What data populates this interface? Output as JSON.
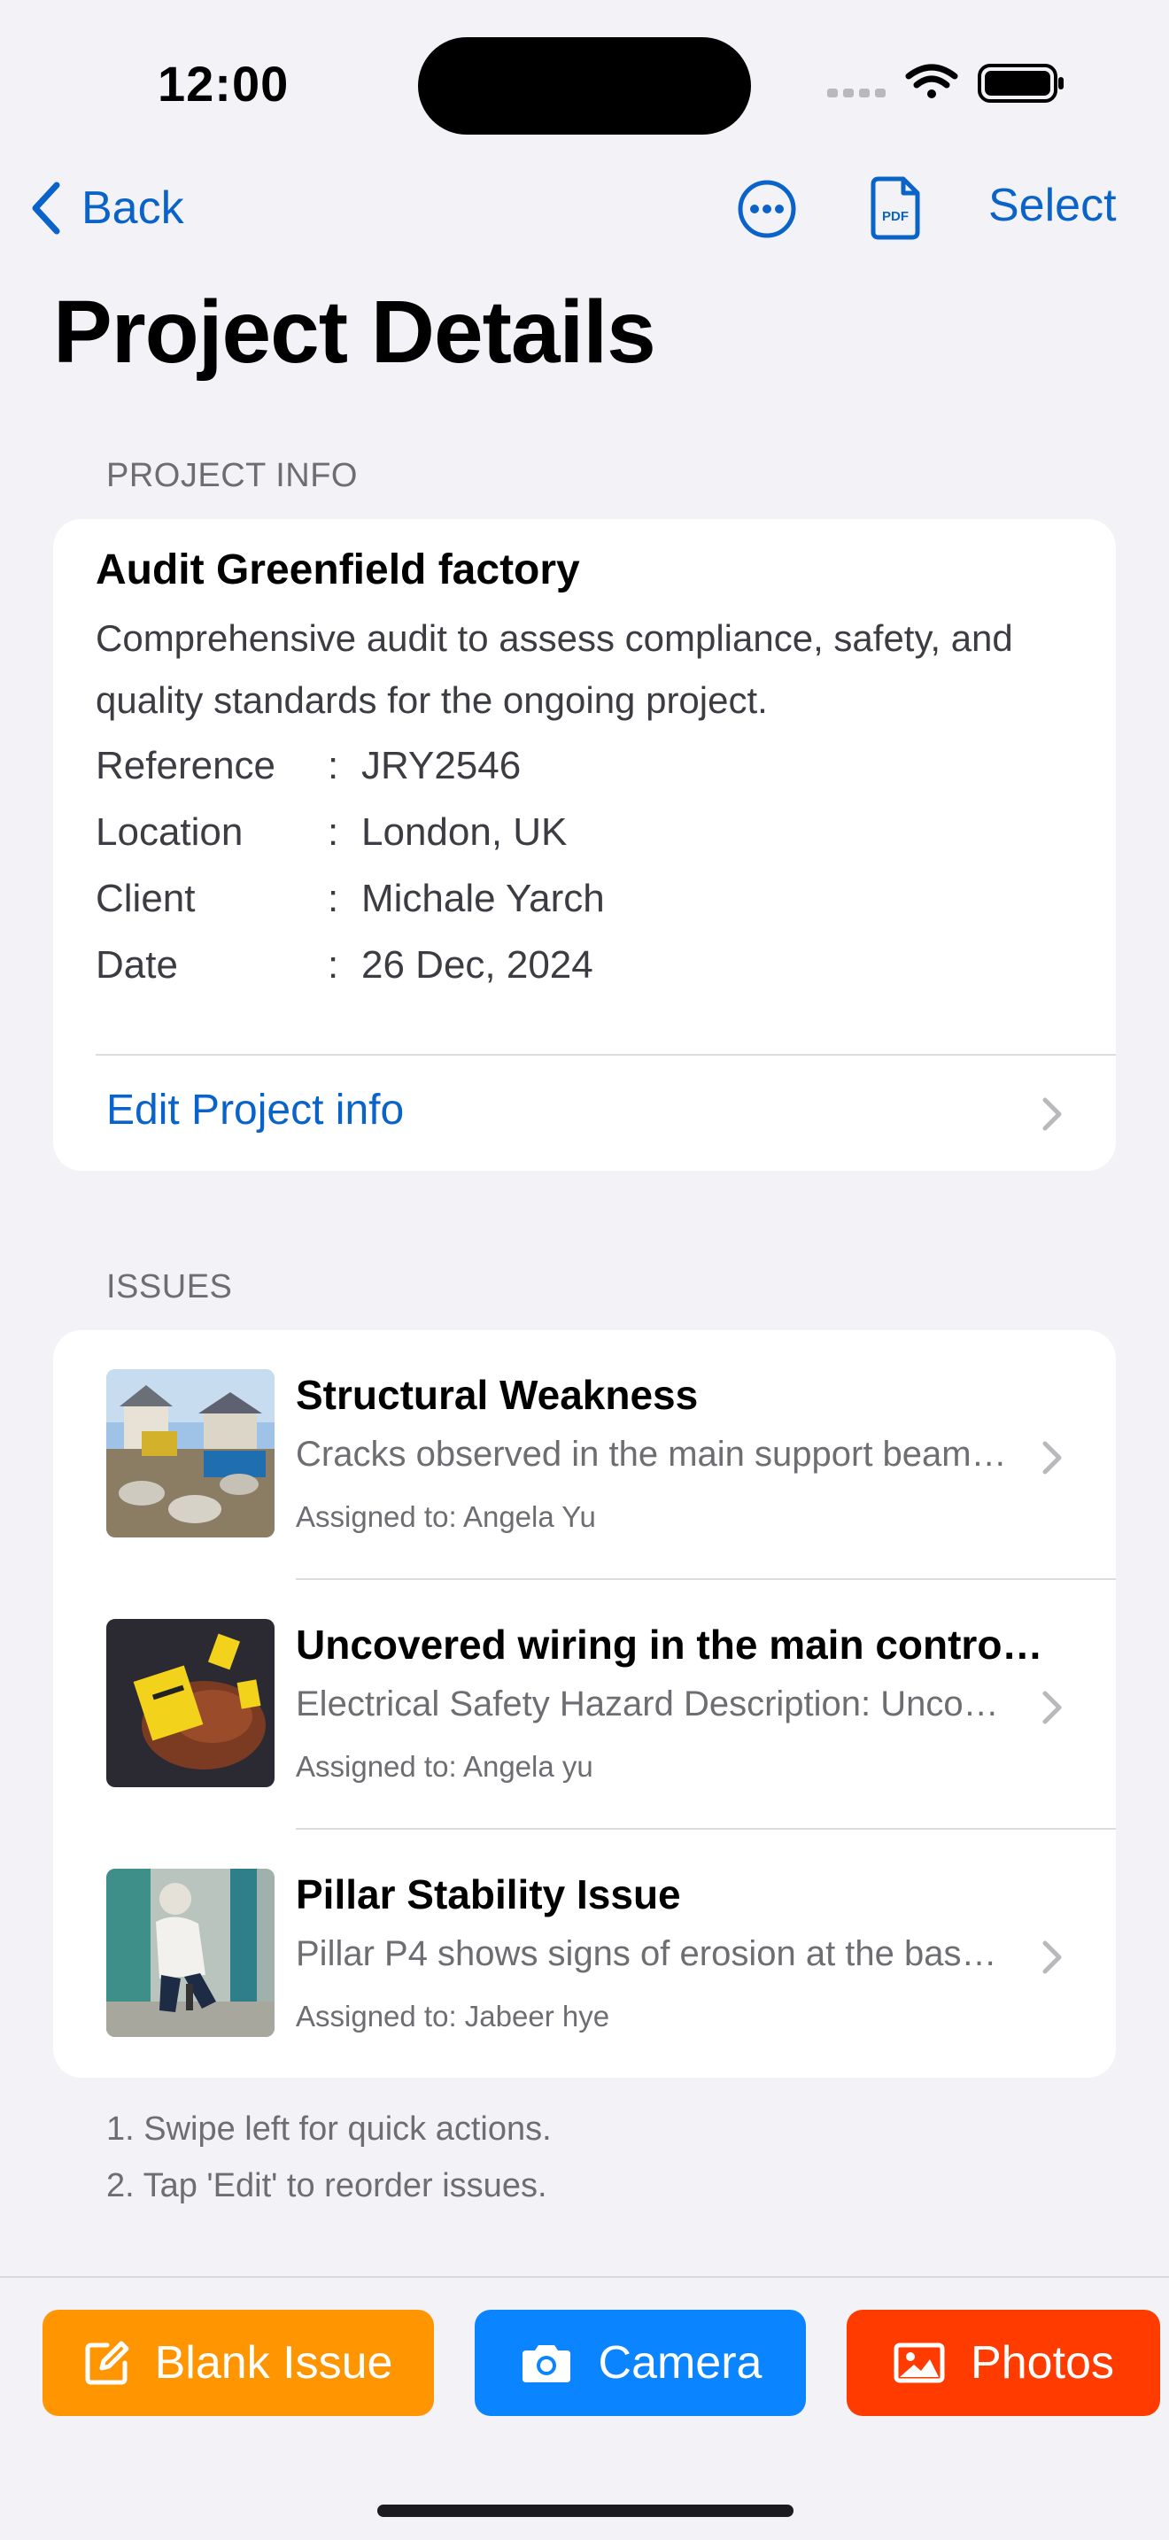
{
  "status_bar": {
    "time": "12:00",
    "icons": [
      "signal-icon",
      "wifi-icon",
      "battery-icon"
    ]
  },
  "nav": {
    "back_label": "Back",
    "select_label": "Select",
    "more_icon": "more-icon",
    "pdf_icon": "pdf-icon",
    "pdf_text": "PDF"
  },
  "page_title": "Project Details",
  "project_info": {
    "header": "PROJECT INFO",
    "title": "Audit Greenfield factory",
    "description": "Comprehensive audit to assess compliance, safety, and quality standards for the ongoing project.",
    "fields": [
      {
        "label": "Reference",
        "value": "JRY2546"
      },
      {
        "label": "Location",
        "value": "London, UK"
      },
      {
        "label": "Client",
        "value": "Michale Yarch"
      },
      {
        "label": "Date",
        "value": "26 Dec, 2024"
      }
    ],
    "separator": ":",
    "edit_label": "Edit Project info"
  },
  "issues": {
    "header": "ISSUES",
    "items": [
      {
        "title": "Structural Weakness",
        "description": "Cracks observed in the main support beam…",
        "assigned": "Assigned to: Angela Yu",
        "thumb_icon": "construction-site-photo"
      },
      {
        "title": "Uncovered wiring in the main contro…",
        "description": "Electrical Safety Hazard Description: Unco…",
        "assigned": "Assigned to: Angela yu",
        "thumb_icon": "electrical-tag-photo"
      },
      {
        "title": "Pillar Stability Issue",
        "description": "Pillar P4 shows signs of erosion at the bas…",
        "assigned": "Assigned to: Jabeer hye",
        "thumb_icon": "pillar-inspection-photo"
      }
    ]
  },
  "hints": [
    "1. Swipe left for quick actions.",
    "2. Tap 'Edit' to reorder issues."
  ],
  "actions": {
    "blank_label": "Blank Issue",
    "camera_label": "Camera",
    "photos_label": "Photos"
  },
  "colors": {
    "accent": "#0a63c9",
    "blank_button": "#ff9500",
    "camera_button": "#0a84ff",
    "photos_button": "#ff3b00",
    "background": "#f2f2f7"
  }
}
